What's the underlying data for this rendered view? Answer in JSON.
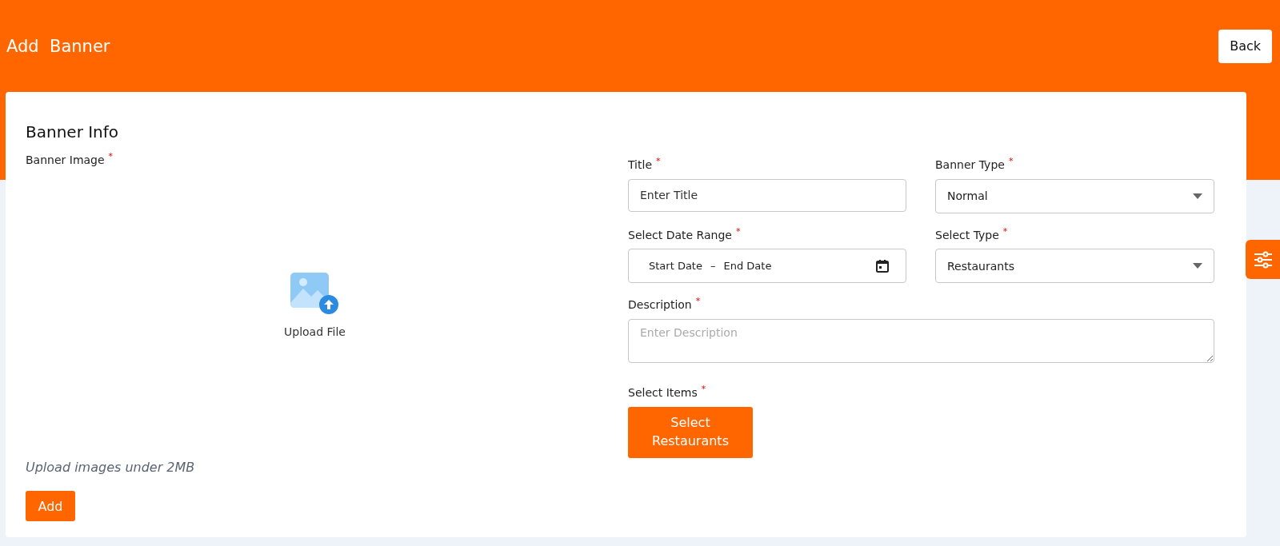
{
  "header": {
    "title": "Add  Banner",
    "back_button": "Back"
  },
  "section_title": "Banner Info",
  "image_field": {
    "label": "Banner Image",
    "required_mark": "*",
    "upload_label": "Upload File",
    "hint": "Upload images under 2MB"
  },
  "add_button": "Add",
  "fields": [
    {
      "kind": "text",
      "label": "Title",
      "required_mark": "*",
      "placeholder": "Enter Title"
    },
    {
      "kind": "select",
      "label": "Banner Type",
      "required_mark": "*",
      "value": "Normal"
    },
    {
      "kind": "daterange",
      "label": "Select Date Range",
      "required_mark": "*",
      "start_placeholder": "Start Date",
      "separator": "–",
      "end_placeholder": "End Date"
    },
    {
      "kind": "select",
      "label": "Select Type",
      "required_mark": "*",
      "value": "Restaurants"
    },
    {
      "kind": "textarea",
      "label": "Description",
      "required_mark": "*",
      "placeholder": "Enter Description"
    }
  ],
  "items_field": {
    "label": "Select Items",
    "required_mark": "*",
    "button": "Select Restaurants"
  }
}
